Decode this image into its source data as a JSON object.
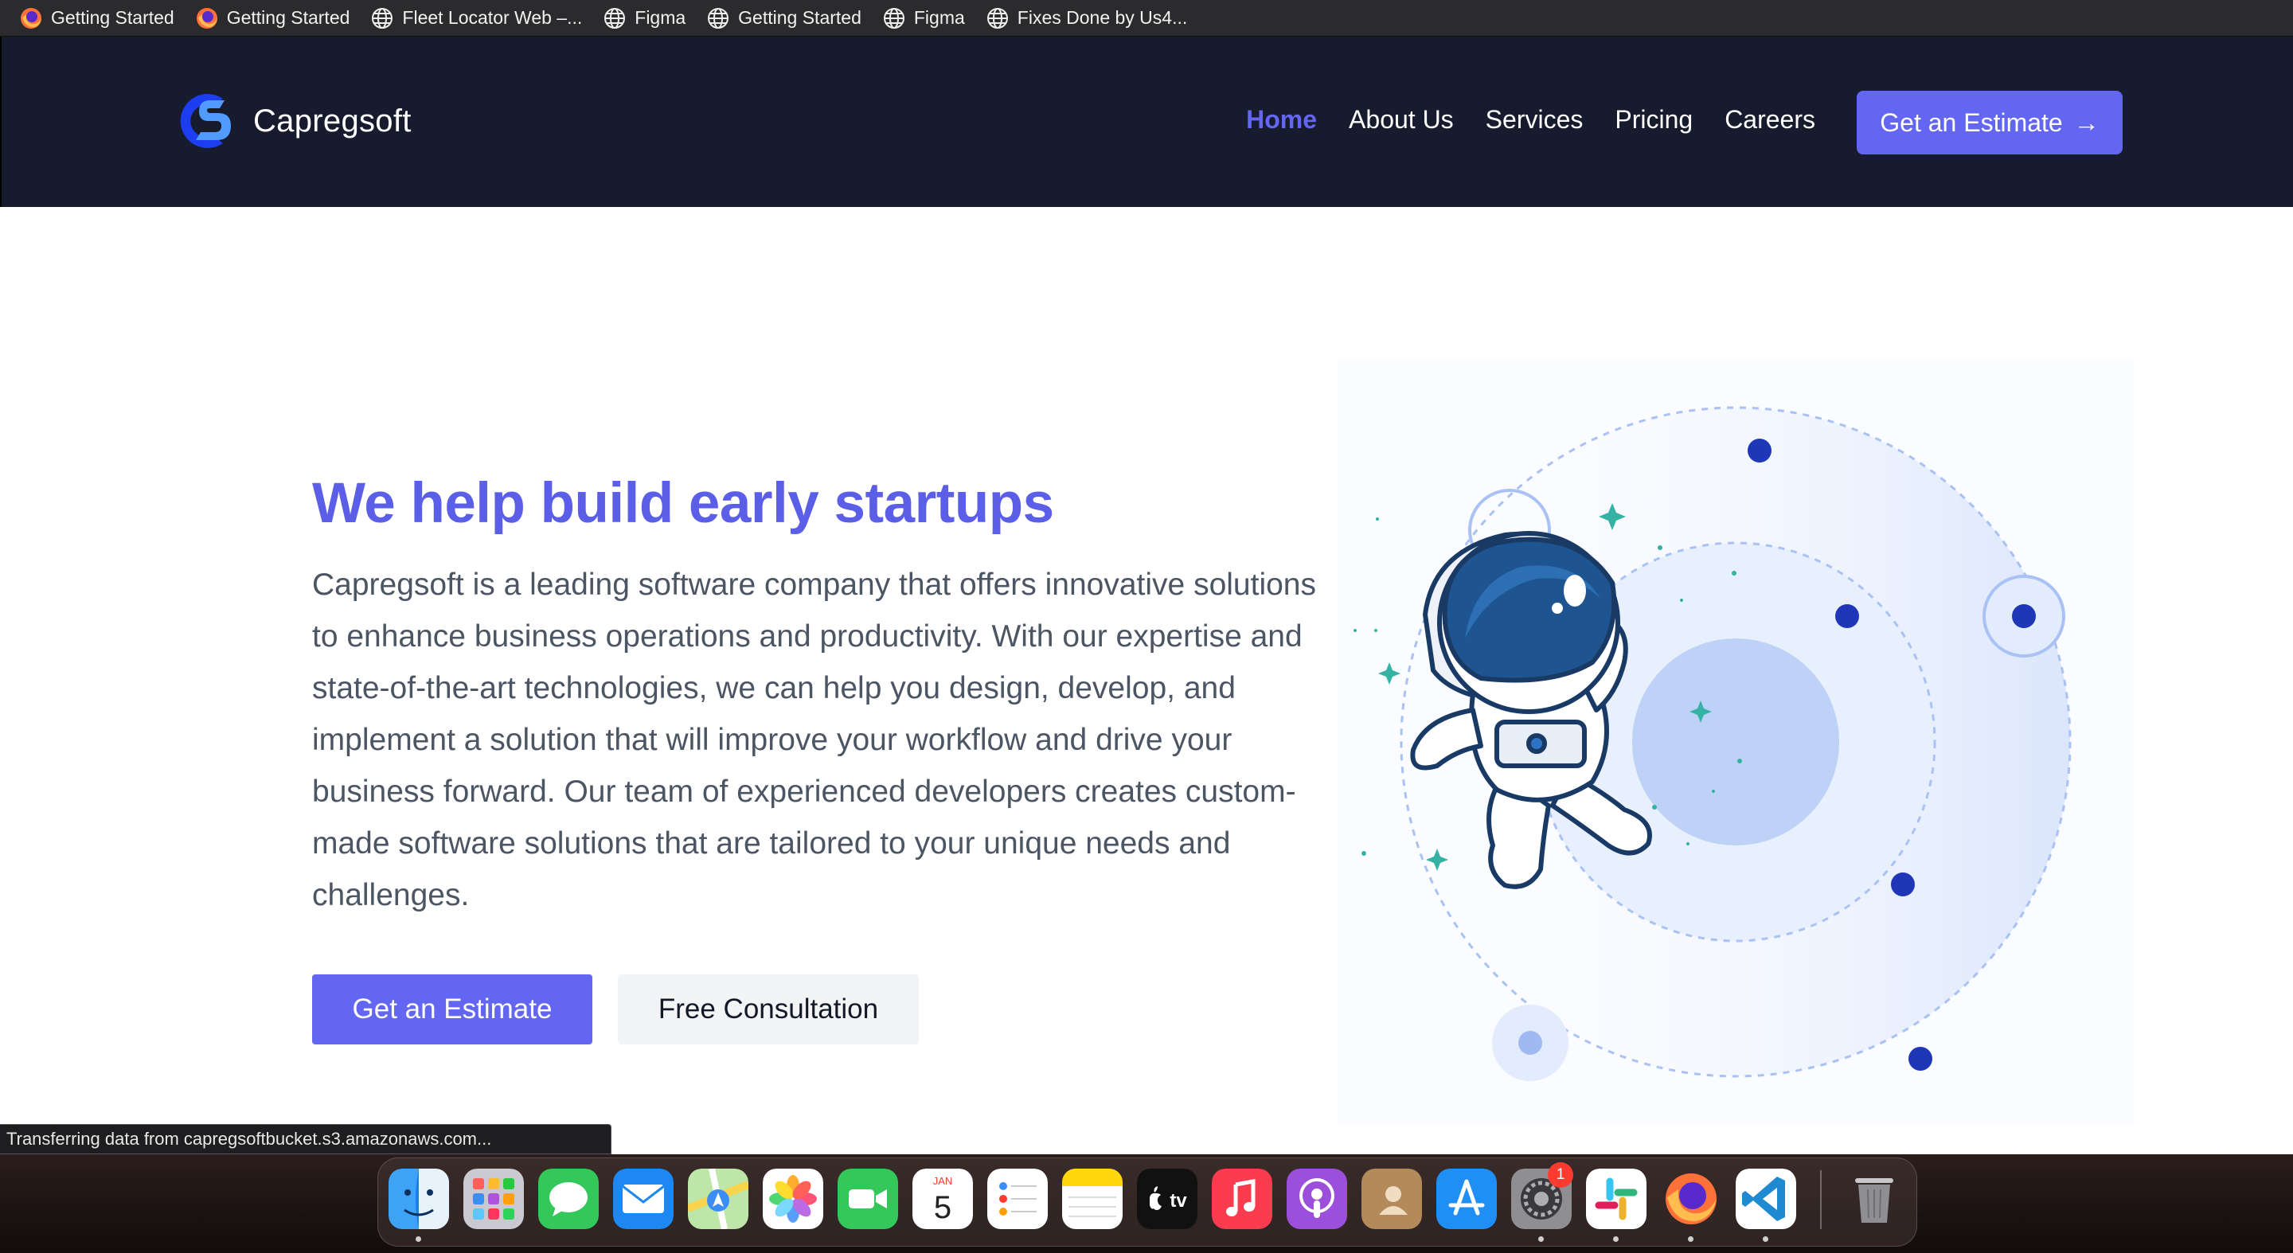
{
  "bookmarks": [
    {
      "label": "Getting Started",
      "icon": "firefox-icon"
    },
    {
      "label": "Getting Started",
      "icon": "firefox-icon"
    },
    {
      "label": "Fleet Locator Web –...",
      "icon": "globe-icon"
    },
    {
      "label": "Figma",
      "icon": "globe-icon"
    },
    {
      "label": "Getting Started",
      "icon": "globe-icon"
    },
    {
      "label": "Figma",
      "icon": "globe-icon"
    },
    {
      "label": "Fixes Done by Us4...",
      "icon": "globe-icon"
    }
  ],
  "site": {
    "brand": "Capregsoft",
    "nav": {
      "items": [
        "Home",
        "About Us",
        "Services",
        "Pricing",
        "Careers"
      ],
      "active": "Home",
      "cta": "Get an Estimate",
      "cta_arrow": "→"
    },
    "hero": {
      "title": "We help build early startups",
      "text": "Capregsoft is a leading software company that offers innovative solutions to enhance business operations and productivity. With our expertise and state-of-the-art technologies, we can help you design, develop, and implement a solution that will improve your workflow and drive your business forward. Our team of experienced developers creates custom-made software solutions that are tailored to your unique needs and challenges.",
      "primary_button": "Get an Estimate",
      "secondary_button": "Free Consultation"
    },
    "colors": {
      "nav_bg": "#161b2e",
      "accent": "#6366f1",
      "title": "#5b5ee6",
      "body_text": "#4b5563"
    }
  },
  "status_bar": {
    "text": "Transferring data from capregsoftbucket.s3.amazonaws.com..."
  },
  "dock": {
    "apps": [
      "Finder",
      "Launchpad",
      "Messages",
      "Mail",
      "Maps",
      "Photos",
      "FaceTime",
      "Calendar",
      "Reminders",
      "Notes",
      "Apple TV",
      "Music",
      "Podcasts",
      "Contacts",
      "App Store",
      "System Settings",
      "Slack",
      "Firefox",
      "Visual Studio Code"
    ],
    "calendar": {
      "month": "JAN",
      "day": "5"
    },
    "tv_label": "tv",
    "settings_badge": "1",
    "trash": "Trash"
  }
}
